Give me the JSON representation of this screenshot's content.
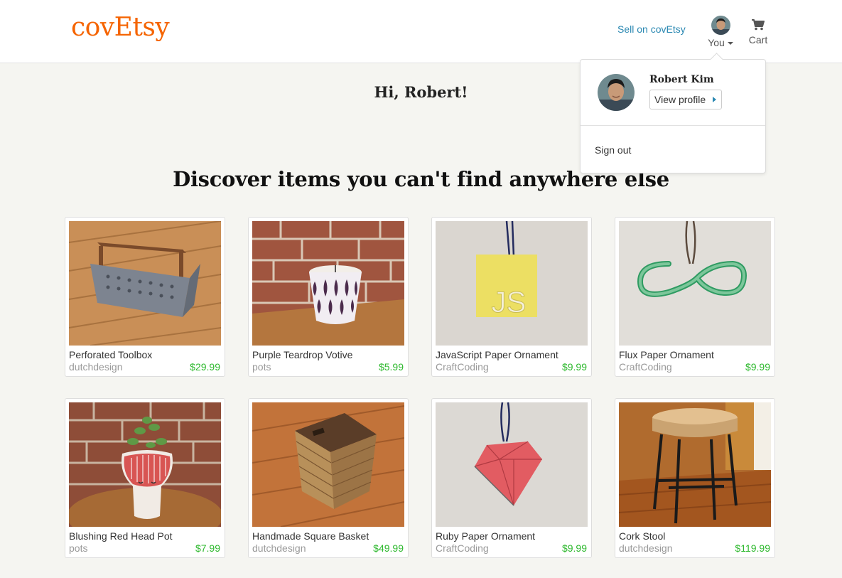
{
  "brand": {
    "name": "covEtsy",
    "color": "#f56400"
  },
  "header": {
    "sell_label": "Sell on covEtsy",
    "you_label": "You",
    "cart_label": "Cart",
    "cart_icon": "cart-icon"
  },
  "dropdown": {
    "name": "Robert Kim",
    "view_profile_label": "View profile",
    "sign_out_label": "Sign out"
  },
  "main": {
    "greeting": "Hi, Robert!",
    "headline": "Discover items you can't find anywhere else"
  },
  "listings": [
    {
      "title": "Perforated Toolbox",
      "shop": "dutchdesign",
      "price": "$29.99"
    },
    {
      "title": "Purple Teardrop Votive",
      "shop": "pots",
      "price": "$5.99"
    },
    {
      "title": "JavaScript Paper Ornament",
      "shop": "CraftCoding",
      "price": "$9.99"
    },
    {
      "title": "Flux Paper Ornament",
      "shop": "CraftCoding",
      "price": "$9.99"
    },
    {
      "title": "Blushing Red Head Pot",
      "shop": "pots",
      "price": "$7.99"
    },
    {
      "title": "Handmade Square Basket",
      "shop": "dutchdesign",
      "price": "$49.99"
    },
    {
      "title": "Ruby Paper Ornament",
      "shop": "CraftCoding",
      "price": "$9.99"
    },
    {
      "title": "Cork Stool",
      "shop": "dutchdesign",
      "price": "$119.99"
    }
  ],
  "colors": {
    "price": "#2fb92f",
    "link": "#2a88b2",
    "background": "#f5f5f1"
  }
}
